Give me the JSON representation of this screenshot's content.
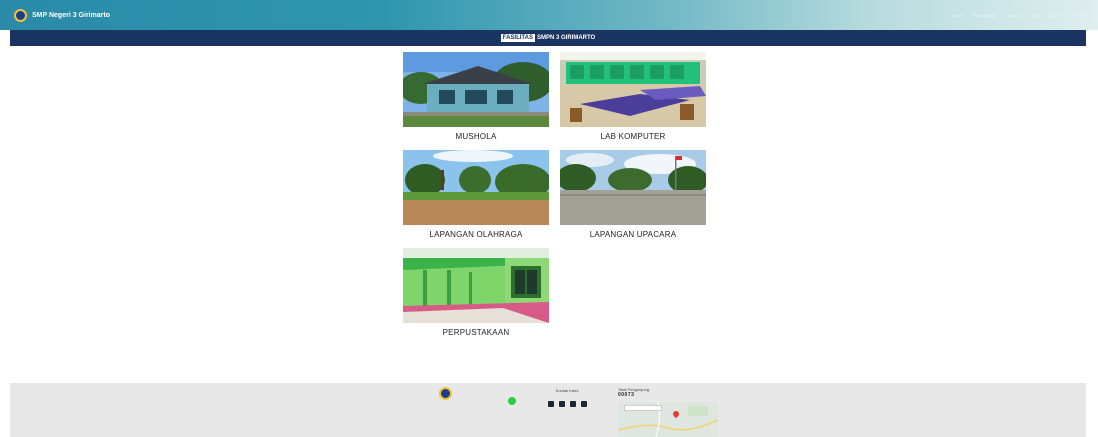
{
  "header": {
    "site_title": "SMP Negeri 3 Girimarto",
    "nav": [
      "Home",
      "Profil Sekolah",
      "Informasi",
      "Galeri",
      "Guru Tamu",
      "PPDB"
    ]
  },
  "banner": {
    "highlight": "FASILITAS",
    "rest": "SMPN 3 GIRIMARTO"
  },
  "facilities": [
    {
      "caption": "MUSHOLA",
      "image": "mushola-photo"
    },
    {
      "caption": "LAB KOMPUTER",
      "image": "lab-komputer-photo"
    },
    {
      "caption": "LAPANGAN OLAHRAGA",
      "image": "lapangan-olahraga-photo"
    },
    {
      "caption": "LAPANGAN UPACARA",
      "image": "lapangan-upacara-photo"
    },
    {
      "caption": "PERPUSTAKAAN",
      "image": "perpustakaan-photo"
    }
  ],
  "footer": {
    "col2_title": "Kontak Kami",
    "col3_title": "Total Pengunjung",
    "visitor_count": "00073"
  },
  "colors": {
    "banner_bg": "#1b3562",
    "footer_bg": "#e8e8e8"
  }
}
